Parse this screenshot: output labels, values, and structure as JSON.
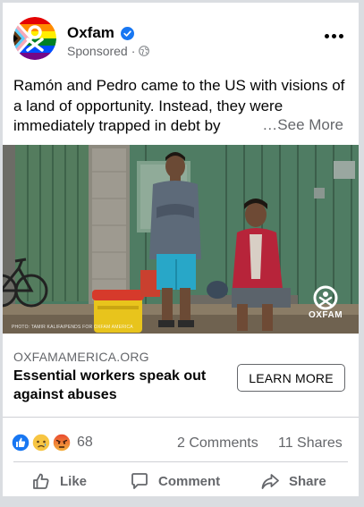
{
  "post": {
    "page_name": "Oxfam",
    "sponsored": "Sponsored",
    "separator": "·",
    "text": "Ramón and Pedro came to the US with visions of a land of opportunity. Instead, they were immediately trapped in debt by",
    "see_more": "…See More",
    "photo_credit": "PHOTO: TAMIR KALIFA/PENDS FOR OXFAM AMERICA",
    "watermark": "OXFAM"
  },
  "link": {
    "domain": "OXFAMAMERICA.ORG",
    "title": "Essential workers speak out against abuses",
    "cta": "LEARN MORE"
  },
  "stats": {
    "reactions_count": "68",
    "reactions": [
      "like-icon",
      "sad-icon",
      "angry-icon"
    ],
    "comments": "2 Comments",
    "shares": "11 Shares"
  },
  "actions": {
    "like": "Like",
    "comment": "Comment",
    "share": "Share"
  },
  "colors": {
    "like_blue": "#1877f2",
    "muted_text": "#65676b",
    "verified": "#1877f2"
  }
}
